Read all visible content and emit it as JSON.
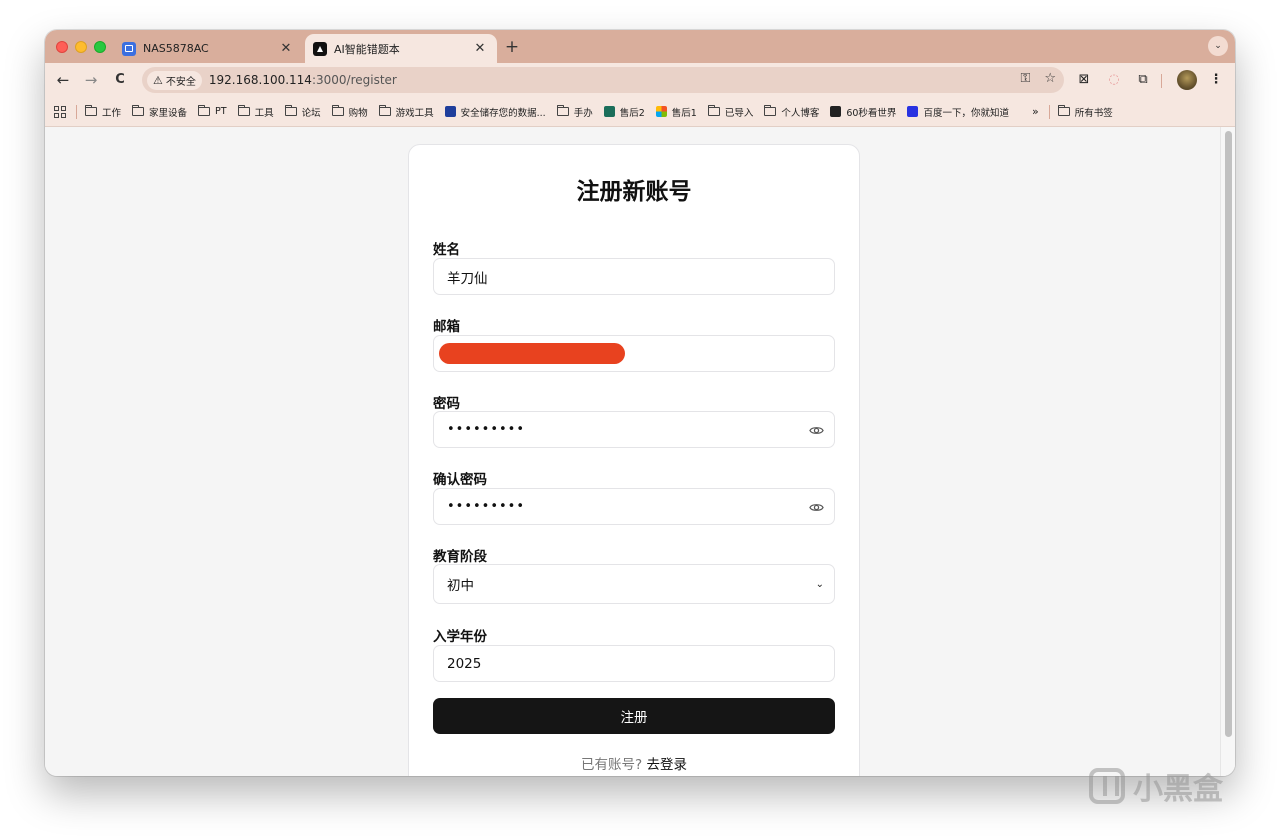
{
  "browser": {
    "tabs": [
      {
        "title": "NAS5878AC",
        "active": false,
        "favicon": "nas-icon"
      },
      {
        "title": "AI智能错题本",
        "active": true,
        "favicon": "ai-app-icon"
      }
    ],
    "new_tab_label": "+",
    "tab_close_glyph": "✕",
    "tab_menu_glyph": "⌄",
    "nav": {
      "back": "←",
      "forward": "→",
      "reload": "C"
    },
    "omnibox": {
      "security_label": "不安全",
      "security_glyph": "⚠",
      "url_host": "192.168.100.114",
      "url_path": ":3000/register"
    },
    "bookmarks": [
      {
        "label": "工作",
        "type": "folder"
      },
      {
        "label": "家里设备",
        "type": "folder"
      },
      {
        "label": "PT",
        "type": "folder"
      },
      {
        "label": "工具",
        "type": "folder"
      },
      {
        "label": "论坛",
        "type": "folder"
      },
      {
        "label": "购物",
        "type": "folder"
      },
      {
        "label": "游戏工具",
        "type": "folder"
      },
      {
        "label": "安全储存您的数据...",
        "type": "link",
        "icon": "shield-icon"
      },
      {
        "label": "手办",
        "type": "folder"
      },
      {
        "label": "售后2",
        "type": "link",
        "icon": "s-icon"
      },
      {
        "label": "售后1",
        "type": "link",
        "icon": "microsoft-icon"
      },
      {
        "label": "已导入",
        "type": "folder"
      },
      {
        "label": "个人博客",
        "type": "folder"
      },
      {
        "label": "60秒看世界",
        "type": "link",
        "icon": "60s-icon"
      },
      {
        "label": "百度一下，你就知道",
        "type": "link",
        "icon": "baidu-icon"
      }
    ],
    "bookmarks_more": "»",
    "all_bookmarks": "所有书签"
  },
  "form": {
    "title": "注册新账号",
    "name_label": "姓名",
    "name_value": "羊刀仙",
    "email_label": "邮箱",
    "password_label": "密码",
    "password_mask": "•••••••••",
    "confirm_label": "确认密码",
    "confirm_mask": "•••••••••",
    "education_label": "教育阶段",
    "education_value": "初中",
    "year_label": "入学年份",
    "year_value": "2025",
    "submit_label": "注册",
    "login_prompt": "已有账号?",
    "login_link": "去登录"
  },
  "watermark_text": "小黑盒",
  "colors": {
    "tab_strip": "#d9ae9c",
    "toolbar": "#f6e7e0",
    "submit_button": "#151515",
    "redaction": "#e8421f"
  }
}
